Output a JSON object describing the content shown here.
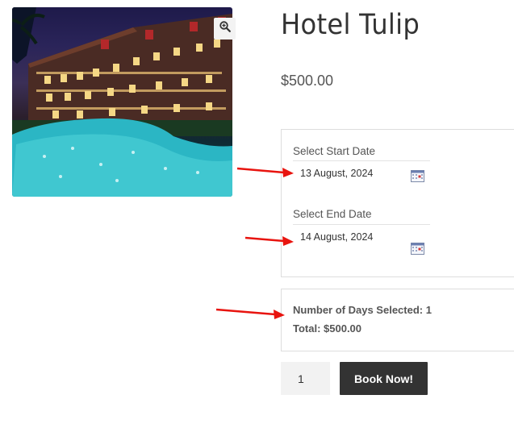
{
  "product": {
    "title": "Hotel Tulip",
    "price": "$500.00"
  },
  "booking": {
    "start_label": "Select Start Date",
    "start_value": "13 August, 2024",
    "end_label": "Select End Date",
    "end_value": "14 August, 2024"
  },
  "summary": {
    "days_line": "Number of Days Selected: 1",
    "total_line": "Total: $500.00"
  },
  "cart": {
    "quantity": "1",
    "book_label": "Book Now!"
  },
  "colors": {
    "annotation_arrow": "#e8140f",
    "button_bg": "#333333"
  },
  "icons": [
    "zoom-in-icon",
    "calendar-icon"
  ]
}
